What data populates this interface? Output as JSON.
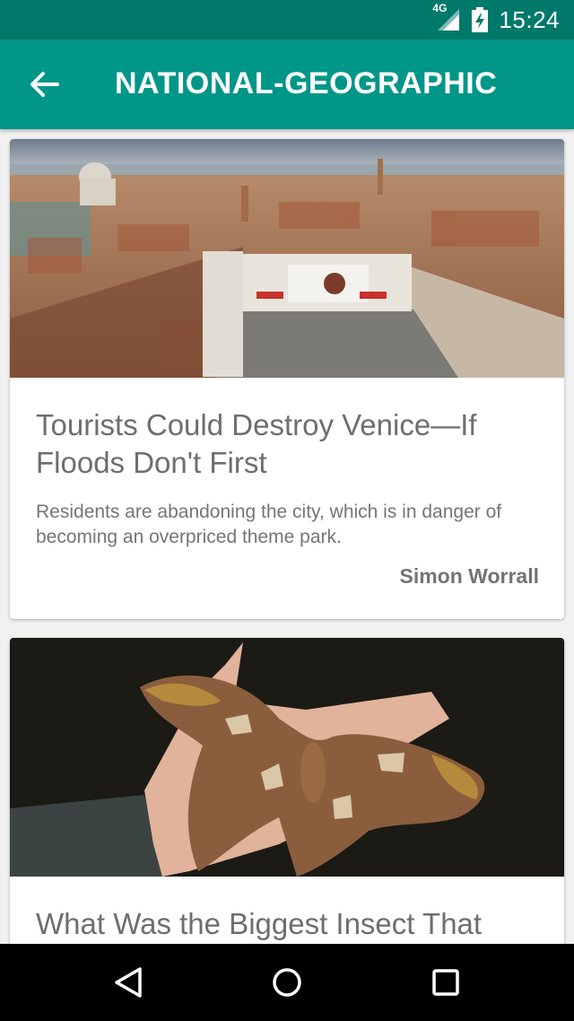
{
  "status_bar": {
    "network_type": "4G",
    "time": "15:24"
  },
  "app_bar": {
    "title": "NATIONAL-GEOGRAPHIC",
    "back_icon": "arrow-back-icon"
  },
  "articles": [
    {
      "title": "Tourists Could Destroy Venice—If Floods Don't First",
      "summary": "Residents are abandoning the city, which is in danger of becoming an overpriced theme park.",
      "author": "Simon Worrall",
      "image": "venice-aerial-photo"
    },
    {
      "title": "What Was the Biggest Insect That",
      "image": "atlas-moth-on-hand-photo"
    }
  ],
  "nav_bar": {
    "back_icon": "triangle-back-icon",
    "home_icon": "circle-home-icon",
    "recents_icon": "square-recents-icon"
  },
  "colors": {
    "status_bar": "#00796b",
    "app_bar": "#009688",
    "background": "#f1f1f1",
    "text": "#6e6e6e"
  }
}
